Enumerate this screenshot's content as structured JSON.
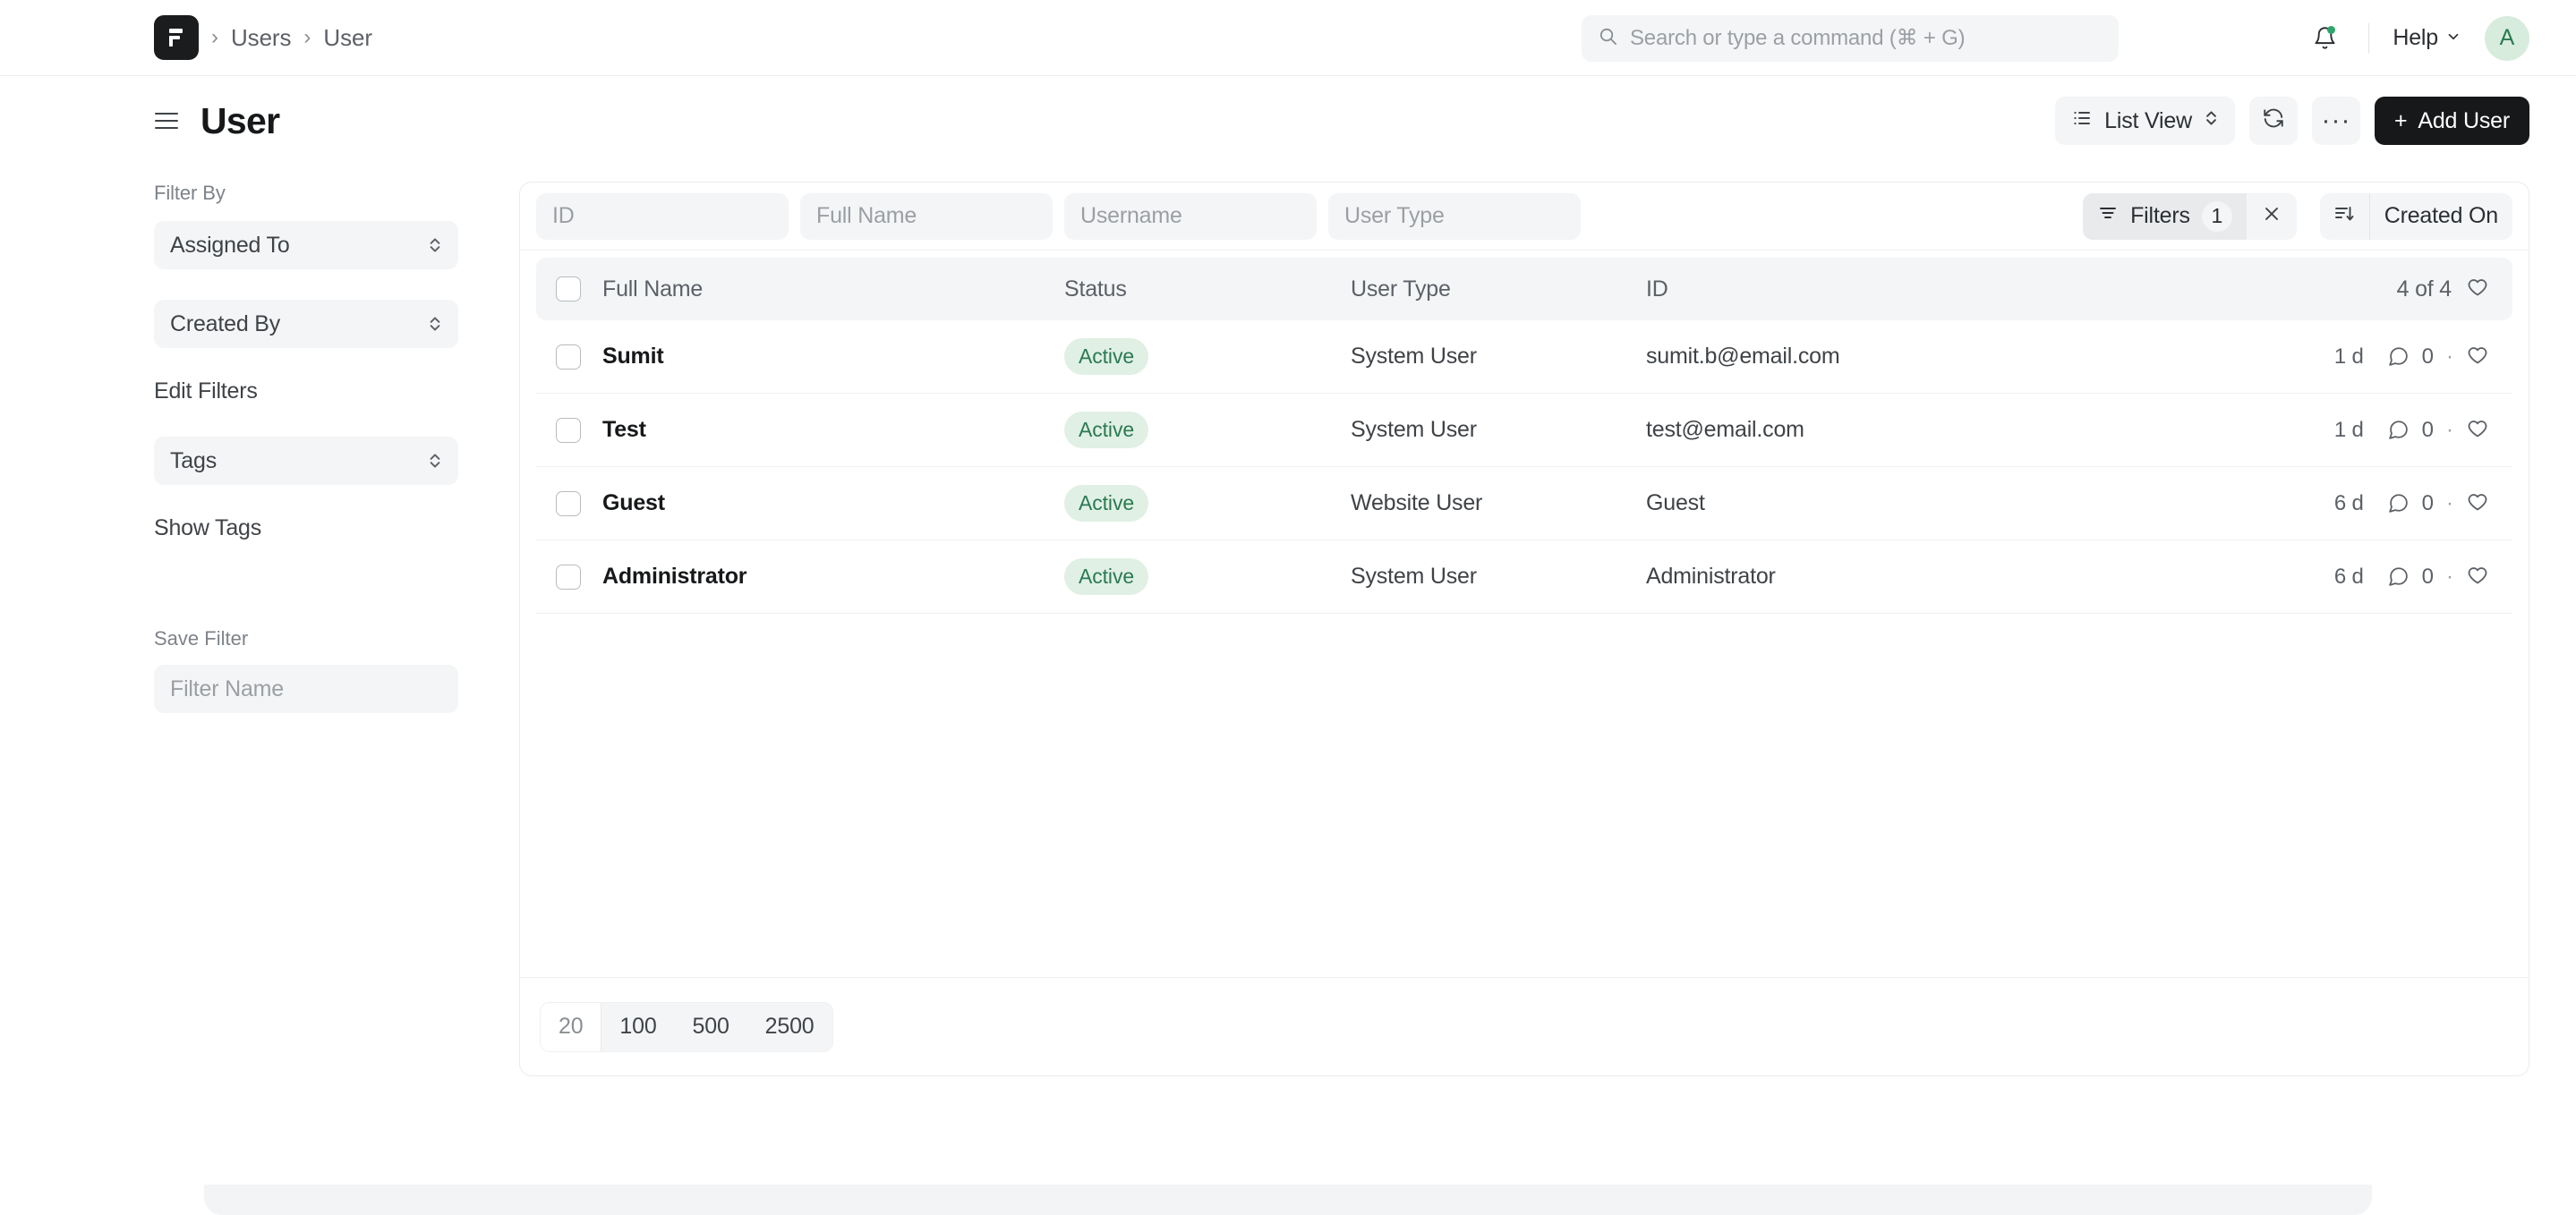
{
  "navbar": {
    "logo_icon": "frappe-logo-icon",
    "breadcrumbs": [
      {
        "label": "Users",
        "icon": "chevron-right-icon"
      },
      {
        "label": "User",
        "icon": "chevron-right-icon"
      }
    ],
    "search": {
      "placeholder": "Search or type a command (⌘ + G)",
      "value": "",
      "icon": "search-icon"
    },
    "notifications": {
      "icon": "bell-icon",
      "has_unread": true,
      "dot_color": "#30a46c"
    },
    "help": {
      "label": "Help",
      "icon": "chevron-down-icon"
    },
    "avatar": {
      "initial": "A",
      "bg": "#d7ecdd",
      "fg": "#2a7a52"
    }
  },
  "page_head": {
    "menu_icon": "hamburger-menu-icon",
    "title": "User",
    "list_view": {
      "label": "List View",
      "icon": "list-icon",
      "chevron": "chevron-updown-icon"
    },
    "refresh": {
      "icon": "refresh-icon"
    },
    "more": {
      "label": "···",
      "icon": "ellipsis-icon"
    },
    "add": {
      "label": "Add User",
      "plus": "+"
    }
  },
  "sidebar": {
    "filter_by_label": "Filter By",
    "selects": [
      {
        "label": "Assigned To"
      },
      {
        "label": "Created By"
      }
    ],
    "edit_filters_label": "Edit Filters",
    "tags_select": {
      "label": "Tags"
    },
    "show_tags_label": "Show Tags",
    "save_filter_label": "Save Filter",
    "filter_name_input": {
      "placeholder": "Filter Name",
      "value": ""
    }
  },
  "list": {
    "filter_inputs": [
      {
        "placeholder": "ID",
        "value": ""
      },
      {
        "placeholder": "Full Name",
        "value": ""
      },
      {
        "placeholder": "Username",
        "value": ""
      },
      {
        "placeholder": "User Type",
        "value": ""
      }
    ],
    "filters_button": {
      "label": "Filters",
      "count": "1",
      "icon": "filter-icon",
      "clear_icon": "close-icon"
    },
    "sort": {
      "icon": "sort-descending-icon",
      "label": "Created On"
    },
    "columns": [
      "Full Name",
      "Status",
      "User Type",
      "ID"
    ],
    "result_count": "4 of 4",
    "like_icon": "heart-icon",
    "rows": [
      {
        "full_name": "Sumit",
        "status": "Active",
        "user_type": "System User",
        "id": "sumit.b@email.com",
        "age": "1 d",
        "comments": "0",
        "checked": false
      },
      {
        "full_name": "Test",
        "status": "Active",
        "user_type": "System User",
        "id": "test@email.com",
        "age": "1 d",
        "comments": "0",
        "checked": false
      },
      {
        "full_name": "Guest",
        "status": "Active",
        "user_type": "Website User",
        "id": "Guest",
        "age": "6 d",
        "comments": "0",
        "checked": false
      },
      {
        "full_name": "Administrator",
        "status": "Active",
        "user_type": "System User",
        "id": "Administrator",
        "age": "6 d",
        "comments": "0",
        "checked": false
      }
    ],
    "page_sizes": [
      "20",
      "100",
      "500",
      "2500"
    ],
    "active_page_size": "20"
  },
  "colors": {
    "accent_green": "#2a7a52",
    "badge_bg": "#e0f0e4",
    "primary_button": "#16181a",
    "surface": "#f4f5f6"
  }
}
